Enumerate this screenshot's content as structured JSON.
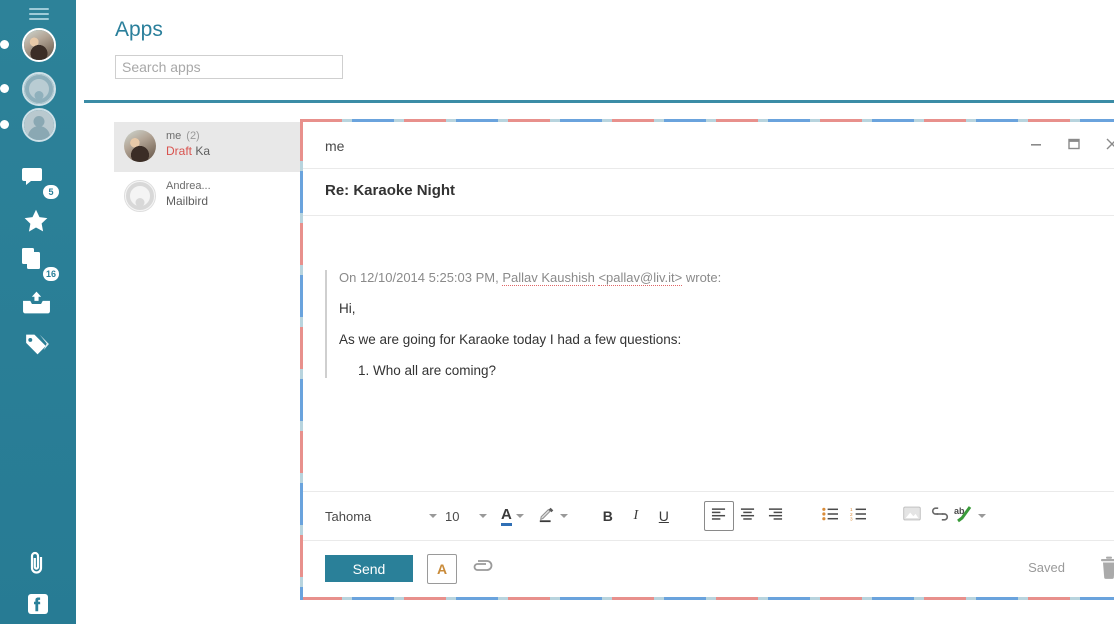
{
  "sidebar": {
    "menu_label": "menu",
    "accounts": [
      {
        "name": "account-photo",
        "has_dot": true
      },
      {
        "name": "account-logo",
        "has_dot": true
      },
      {
        "name": "account-person",
        "has_dot": true
      }
    ],
    "nav": [
      {
        "icon": "chat-icon",
        "badge": "5",
        "label": "Chat"
      },
      {
        "icon": "star-icon",
        "badge": "",
        "label": "Favorites"
      },
      {
        "icon": "documents-icon",
        "badge": "16",
        "label": "Documents"
      },
      {
        "icon": "inbox-upload-icon",
        "badge": "",
        "label": "Inbox"
      },
      {
        "icon": "tags-icon",
        "badge": "",
        "label": "Tags"
      }
    ],
    "bottom": [
      {
        "icon": "paperclip-icon",
        "label": "Attachments"
      },
      {
        "icon": "facebook-icon",
        "label": "Facebook"
      }
    ]
  },
  "header": {
    "title": "Apps",
    "search_placeholder": "Search apps",
    "search_value": ""
  },
  "mail_list": [
    {
      "sender": "me",
      "count": "(2)",
      "status": "Draft",
      "preview": "Ka",
      "selected": true,
      "avatar": "photo"
    },
    {
      "sender": "Andrea...",
      "count": "",
      "status": "",
      "preview": "Mailbird",
      "selected": false,
      "avatar": "ghost"
    }
  ],
  "compose": {
    "window_title": "me",
    "subject": "Re: Karaoke Night",
    "controls": {
      "minimize": "minimize-icon",
      "maximize": "maximize-icon",
      "close": "close-icon"
    },
    "quote": {
      "header_prefix": "On 12/10/2014 5:25:03 PM, ",
      "header_name": "Pallav Kaushish",
      "header_email": "<pallav@liv.it>",
      "header_suffix": " wrote:",
      "greeting": "Hi,",
      "paragraph": "As we are going for Karaoke today I had a few questions:",
      "list_items": [
        "Who all are coming?"
      ]
    },
    "toolbar": {
      "font_family": "Tahoma",
      "font_size": "10",
      "font_color_label": "A",
      "font_color_swatch": "#2f6fb5",
      "highlight_label": "highlight-icon",
      "bold_label": "B",
      "italic_label": "I",
      "underline_label": "U",
      "align_left": "align-left-icon",
      "align_center": "align-center-icon",
      "align_right": "align-right-icon",
      "bullet_list": "bullet-list-icon",
      "numbered_list": "numbered-list-icon",
      "insert_image": "image-icon",
      "insert_link": "link-icon",
      "spellcheck": "spellcheck-icon"
    },
    "actions": {
      "send_label": "Send",
      "format_toggle_label": "A",
      "attach_label": "attachment-icon",
      "saved_label": "Saved",
      "delete_label": "trash-icon"
    }
  },
  "colors": {
    "sidebar_bg": "#2a8099",
    "accent": "#2a8099",
    "title_text": "#2a7f9b",
    "draft_red": "#d9534f",
    "header_rule": "#3b8ca6"
  }
}
